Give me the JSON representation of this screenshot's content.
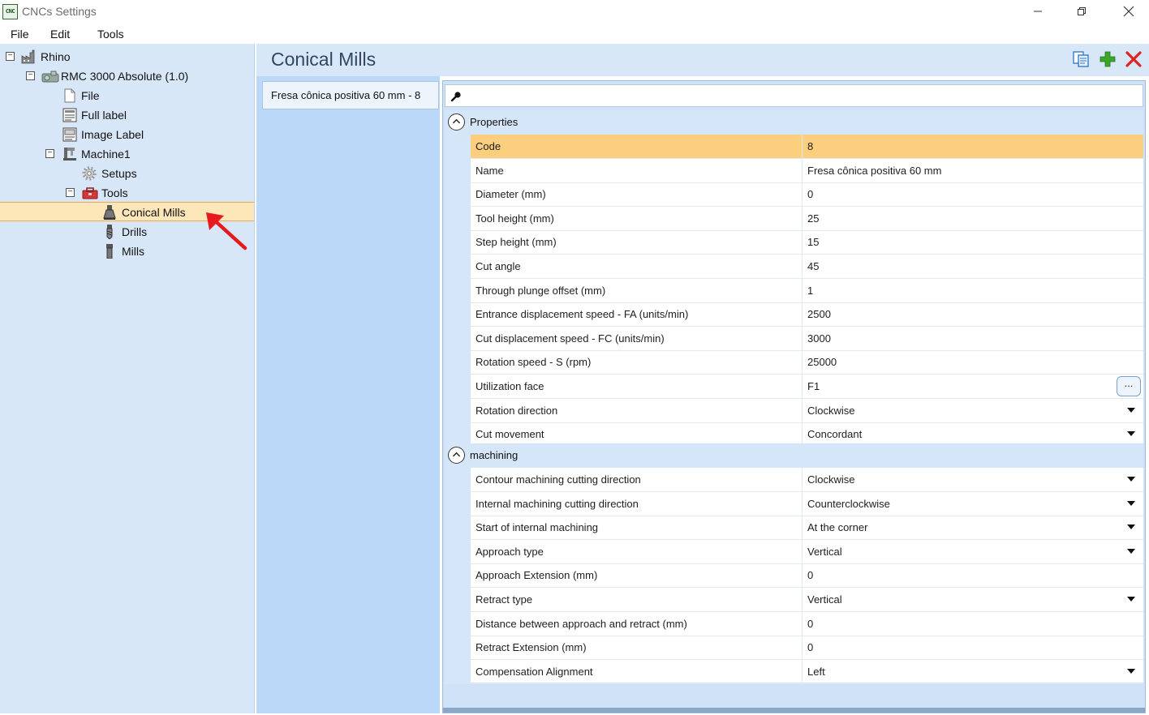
{
  "window": {
    "title": "CNCs Settings",
    "app_icon_text": "CNC"
  },
  "menu": [
    "File",
    "Edit",
    "Tools"
  ],
  "tree": {
    "rhino": "Rhino",
    "rmc": "RMC 3000 Absolute (1.0)",
    "file": "File",
    "full_label": "Full label",
    "image_label": "Image Label",
    "machine1": "Machine1",
    "setups": "Setups",
    "tools": "Tools",
    "conical_mills": "Conical Mills",
    "drills": "Drills",
    "mills": "Mills",
    "selected": "Conical Mills"
  },
  "content": {
    "title": "Conical Mills",
    "list_items": [
      "Fresa cônica positiva 60 mm - 8"
    ]
  },
  "properties_category": "Properties",
  "properties": [
    {
      "name": "Code",
      "value": "8",
      "selected": true
    },
    {
      "name": "Name",
      "value": "Fresa cônica positiva 60 mm"
    },
    {
      "name": "Diameter (mm)",
      "value": "0"
    },
    {
      "name": "Tool height (mm)",
      "value": "25"
    },
    {
      "name": "Step height (mm)",
      "value": "15"
    },
    {
      "name": "Cut angle",
      "value": "45"
    },
    {
      "name": "Through plunge offset (mm)",
      "value": "1"
    },
    {
      "name": "Entrance displacement speed - FA (units/min)",
      "value": "2500"
    },
    {
      "name": "Cut displacement speed - FC (units/min)",
      "value": "3000"
    },
    {
      "name": "Rotation speed - S (rpm)",
      "value": "25000"
    },
    {
      "name": "Utilization face",
      "value": "F1",
      "editor": "ellipsis",
      "ellipsis_label": "..."
    },
    {
      "name": "Rotation direction",
      "value": "Clockwise",
      "editor": "dropdown"
    },
    {
      "name": "Cut movement",
      "value": "Concordant",
      "editor": "dropdown"
    }
  ],
  "machining_category": "machining",
  "machining": [
    {
      "name": "Contour machining cutting direction",
      "value": "Clockwise",
      "editor": "dropdown"
    },
    {
      "name": "Internal machining cutting direction",
      "value": "Counterclockwise",
      "editor": "dropdown"
    },
    {
      "name": "Start of internal machining",
      "value": "At the corner",
      "editor": "dropdown"
    },
    {
      "name": "Approach type",
      "value": "Vertical",
      "editor": "dropdown"
    },
    {
      "name": "Approach Extension (mm)",
      "value": "0"
    },
    {
      "name": "Retract type",
      "value": "Vertical",
      "editor": "dropdown"
    },
    {
      "name": "Distance between approach and retract (mm)",
      "value": "0"
    },
    {
      "name": "Retract Extension (mm)",
      "value": "0"
    },
    {
      "name": "Compensation Alignment",
      "value": "Left",
      "editor": "dropdown"
    }
  ],
  "colors": {
    "selection": "#fbcf7e",
    "tree_selection": "#fde6b8",
    "panel_bg": "#d8e7f8",
    "list_bg": "#bcd8f8",
    "add_green": "#3aa52a",
    "delete_red": "#e0231f",
    "annotation_red": "#e8191d"
  },
  "icons": {
    "copy": "copy-icon",
    "add": "add-icon",
    "delete": "delete-icon",
    "search": "search-icon"
  }
}
